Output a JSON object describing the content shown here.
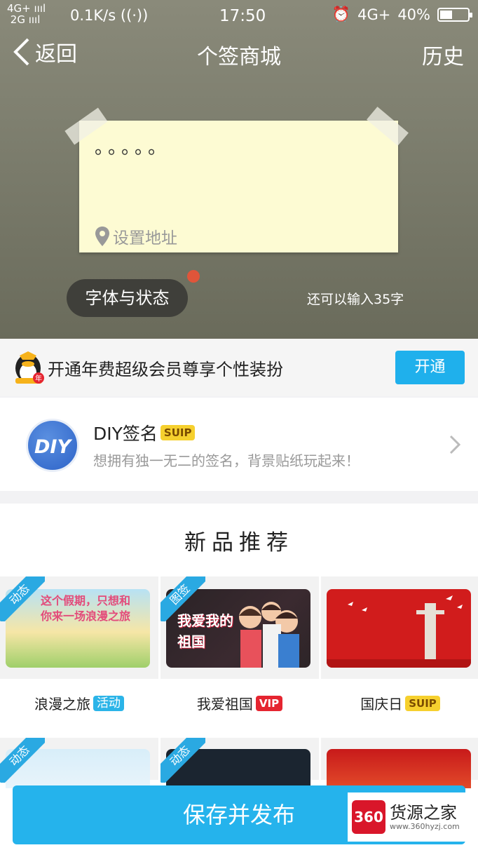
{
  "status_bar": {
    "network_top": "4G+",
    "network_bottom": "2G",
    "speed": "0.1K/s",
    "time": "17:50",
    "network_right": "4G+",
    "battery": "40%"
  },
  "nav": {
    "back_label": "返回",
    "title": "个签商城",
    "history_label": "历史"
  },
  "note": {
    "text": "。。。。。",
    "location_label": "设置地址"
  },
  "editor": {
    "font_status_label": "字体与状态",
    "remaining_label": "还可以输入35字"
  },
  "membership": {
    "text": "开通年费超级会员尊享个性装扮",
    "badge_char": "年",
    "open_label": "开通"
  },
  "diy": {
    "logo_text": "DIY",
    "title": "DIY签名",
    "badge": "SUIP",
    "subtitle": "想拥有独一无二的签名，背景贴纸玩起来！"
  },
  "new_products": {
    "title": "新品推荐",
    "items": [
      {
        "ribbon": "动态",
        "name": "浪漫之旅",
        "badge": "活动",
        "badge_type": "act",
        "thumb_text": "这个假期，只想和你来一场浪漫之旅"
      },
      {
        "ribbon": "图签",
        "name": "我爱祖国",
        "badge": "VIP",
        "badge_type": "vip",
        "thumb_text": "我爱我的祖国"
      },
      {
        "ribbon": "",
        "name": "国庆日",
        "badge": "SUIP",
        "badge_type": "suip",
        "thumb_text": ""
      }
    ],
    "row2_ribbons": [
      "动态",
      "动态",
      ""
    ]
  },
  "save_button": {
    "label": "保存并发布"
  },
  "watermark": {
    "logo": "360",
    "text": "货源之家",
    "url": "www.360hyzj.com"
  },
  "colors": {
    "accent": "#1fb0ec",
    "vip_red": "#e52530",
    "suip_yellow": "#f6d02e",
    "note_bg": "#fdfbd3"
  }
}
